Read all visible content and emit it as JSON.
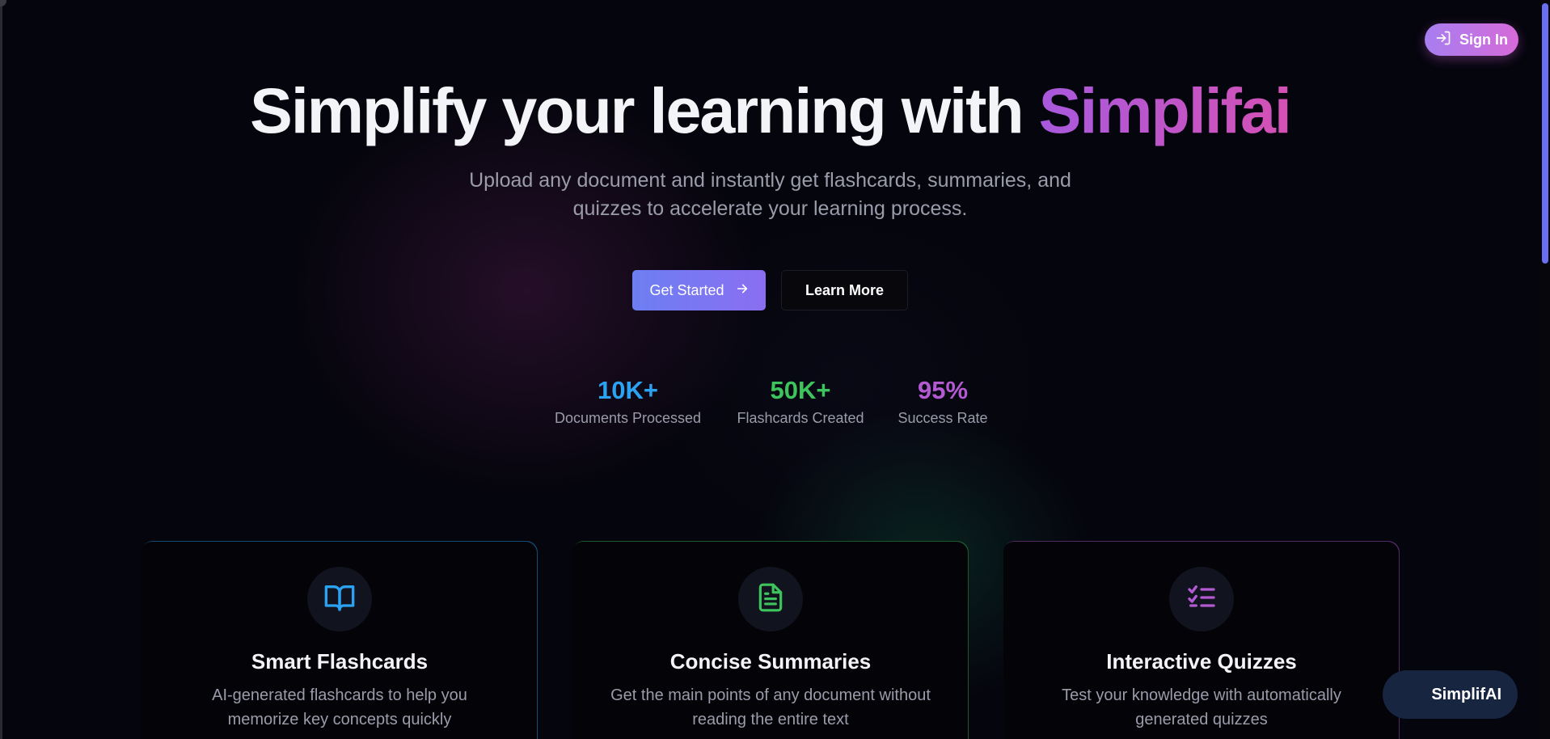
{
  "header": {
    "signin_label": "Sign In"
  },
  "hero": {
    "title_main": "Simplify your learning with ",
    "title_accent": "Simplifai",
    "subtitle_line1": "Upload any document and instantly get flashcards, summaries, and",
    "subtitle_line2": "quizzes to accelerate your learning process."
  },
  "buttons": {
    "get_started": "Get Started",
    "learn_more": "Learn More"
  },
  "stats": [
    {
      "value": "10K+",
      "label": "Documents Processed",
      "color": "#2ba3f2"
    },
    {
      "value": "50K+",
      "label": "Flashcards Created",
      "color": "#3ec45c"
    },
    {
      "value": "95%",
      "label": "Success Rate",
      "color": "#b35ad3"
    }
  ],
  "features": [
    {
      "title": "Smart Flashcards",
      "desc_line1": "AI-generated flashcards to help you",
      "desc_line2": "memorize key concepts quickly",
      "icon": "book-open-icon",
      "accent": "#2ba3f2"
    },
    {
      "title": "Concise Summaries",
      "desc_line1": "Get the main points of any document without",
      "desc_line2": "reading the entire text",
      "icon": "file-text-icon",
      "accent": "#3ec45c"
    },
    {
      "title": "Interactive Quizzes",
      "desc_line1": "Test your knowledge with automatically",
      "desc_line2": "generated quizzes",
      "icon": "list-checks-icon",
      "accent": "#b35ad3"
    }
  ],
  "chip": {
    "label": "SimplifAI"
  }
}
